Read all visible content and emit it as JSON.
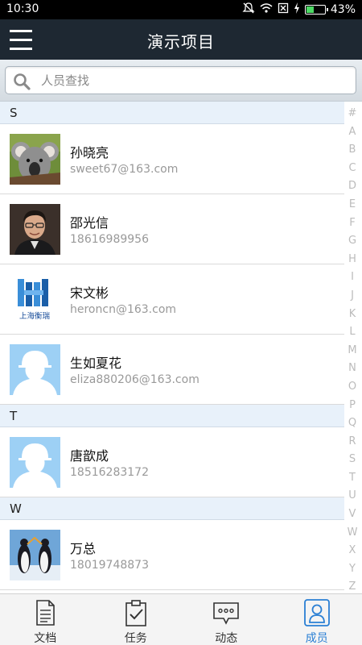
{
  "status_bar": {
    "time": "10:30",
    "battery": "43%",
    "battery_level": 0.43
  },
  "app_bar": {
    "title": "演示项目",
    "menu_icon": "menu-icon"
  },
  "search": {
    "placeholder": "人员查找",
    "value": ""
  },
  "colors": {
    "header": "#1e2832",
    "section_bg": "#e8f1fa",
    "active_tab": "#2a7fd4"
  },
  "sections": [
    {
      "letter": "S",
      "members": [
        {
          "name": "孙晓亮",
          "contact": "sweet67@163.com",
          "avatar": "koala-photo"
        },
        {
          "name": "邵光信",
          "contact": "18616989956",
          "avatar": "man-portrait-photo"
        },
        {
          "name": "宋文彬",
          "contact": "heroncn@163.com",
          "avatar": "company-logo",
          "logo_text": "上海衡瑞"
        },
        {
          "name": "生如夏花",
          "contact": "eliza880206@163.com",
          "avatar": "default-worker-avatar"
        }
      ]
    },
    {
      "letter": "T",
      "members": [
        {
          "name": "唐歆成",
          "contact": "18516283172",
          "avatar": "default-worker-avatar"
        }
      ]
    },
    {
      "letter": "W",
      "members": [
        {
          "name": "万总",
          "contact": "18019748873",
          "avatar": "penguins-photo"
        }
      ]
    }
  ],
  "index_letters": [
    "#",
    "A",
    "B",
    "C",
    "D",
    "E",
    "F",
    "G",
    "H",
    "I",
    "J",
    "K",
    "L",
    "M",
    "N",
    "O",
    "P",
    "Q",
    "R",
    "S",
    "T",
    "U",
    "V",
    "W",
    "X",
    "Y",
    "Z"
  ],
  "tabs": [
    {
      "label": "文档",
      "icon": "document-icon",
      "active": false
    },
    {
      "label": "任务",
      "icon": "clipboard-check-icon",
      "active": false
    },
    {
      "label": "动态",
      "icon": "chat-bubble-icon",
      "active": false
    },
    {
      "label": "成员",
      "icon": "person-icon",
      "active": true
    }
  ]
}
